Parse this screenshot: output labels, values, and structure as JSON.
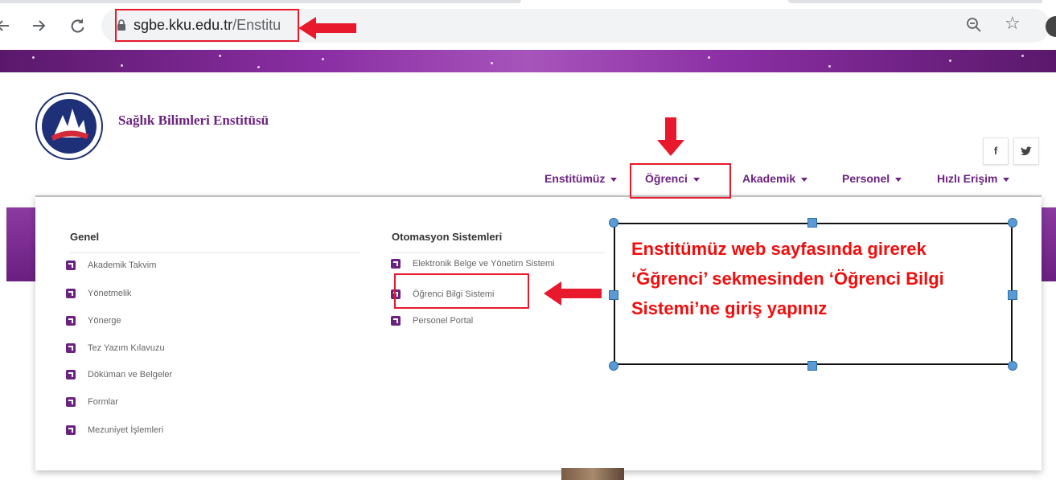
{
  "browser": {
    "url_domain": "sgbe.kku.edu.tr",
    "url_path": "/Enstitu",
    "back_icon": "arrow-left",
    "forward_icon": "arrow-right",
    "reload_icon": "reload",
    "star_icon": "☆"
  },
  "site": {
    "title": "Sağlık Bilimleri Enstitüsü",
    "social": [
      "f",
      "🐦"
    ]
  },
  "nav": {
    "items": [
      {
        "label": "Enstitümüz"
      },
      {
        "label": "Öğrenci"
      },
      {
        "label": "Akademik"
      },
      {
        "label": "Personel"
      },
      {
        "label": "Hızlı Erişim"
      }
    ]
  },
  "dropdown": {
    "genel": {
      "heading": "Genel",
      "links": [
        "Akademik Takvim",
        "Yönetmelik",
        "Yönerge",
        "Tez Yazım Kılavuzu",
        "Döküman ve Belgeler",
        "Formlar",
        "Mezuniyet İşlemleri"
      ]
    },
    "otomasyon": {
      "heading": "Otomasyon Sistemleri",
      "links": [
        "Elektronik Belge ve Yönetim Sistemi",
        "Öğrenci Bilgi Sistemi",
        "Personel Portal"
      ]
    }
  },
  "annotation": {
    "text": "Enstitümüz web sayfasında girerek ‘Ğğrenci’ sekmesinden ‘Öğrenci Bilgi Sistemi’ne giriş yapınız",
    "highlight_color": "#e8192c"
  },
  "colors": {
    "brand_purple": "#6b2280",
    "annotation_red": "#f20d0d",
    "handle_blue": "#5b9bd5"
  }
}
